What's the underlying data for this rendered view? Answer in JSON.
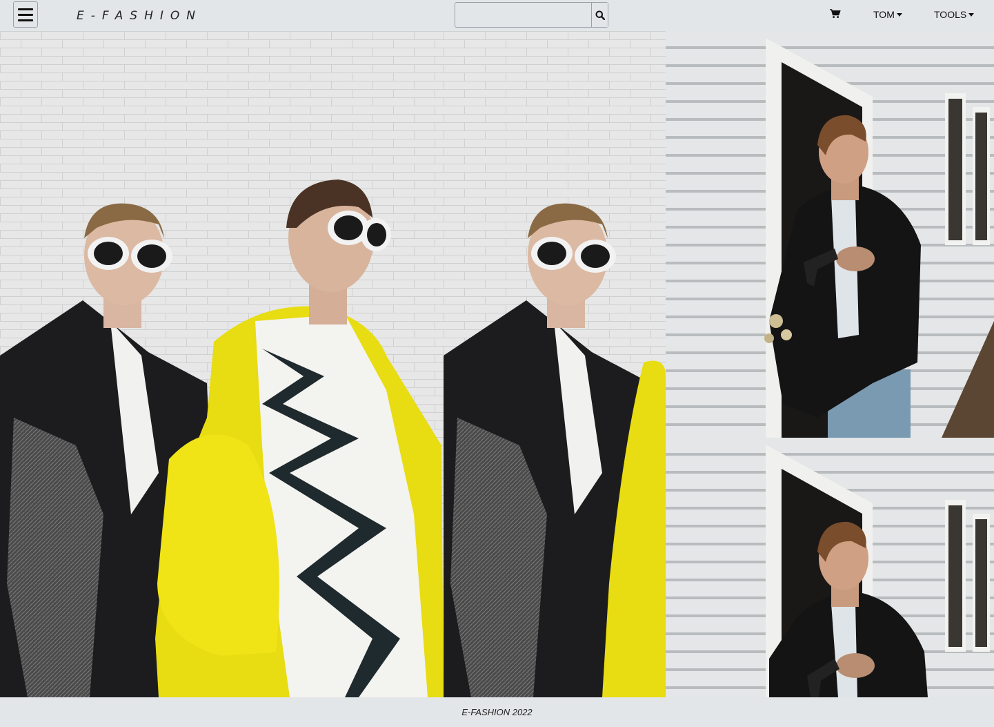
{
  "header": {
    "brand": "E-FASHION",
    "search": {
      "value": "",
      "placeholder": ""
    },
    "nav": {
      "user_label": "TOM",
      "tools_label": "TOOLS"
    },
    "icons": {
      "menu": "hamburger-menu-icon",
      "search": "search-icon",
      "cart": "shopping-cart-icon",
      "dropdown": "caret-down-icon"
    }
  },
  "footer": {
    "text": "E-FASHION 2022"
  },
  "theme": {
    "bar_background": "#e3e6e9",
    "text": "#111111",
    "border": "#9aa0a6"
  }
}
